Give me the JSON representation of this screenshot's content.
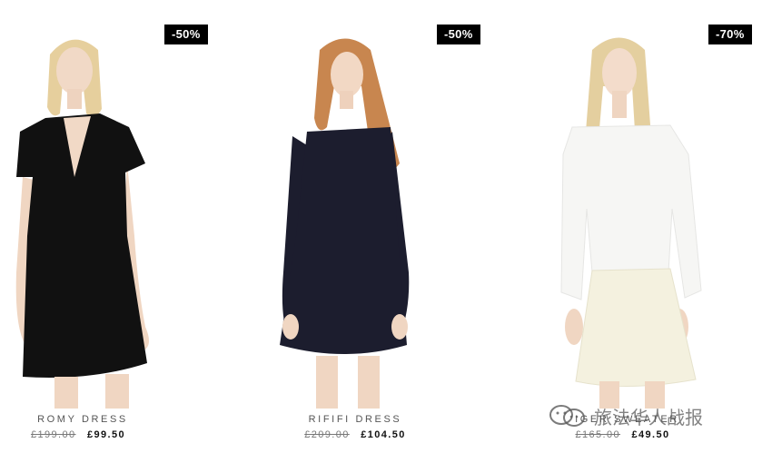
{
  "products": [
    {
      "name": "ROMY DRESS",
      "discount": "-50%",
      "old_price": "£199.00",
      "new_price": "£99.50",
      "garment_color": "#111111"
    },
    {
      "name": "RIFIFI DRESS",
      "discount": "-50%",
      "old_price": "£209.00",
      "new_price": "£104.50",
      "garment_color": "#1c1d2e"
    },
    {
      "name": "IGER SWEATER",
      "discount": "-70%",
      "old_price": "£165.00",
      "new_price": "£49.50",
      "garment_color": "#f6f6f4"
    }
  ],
  "watermark": {
    "text": "旅法华人战报"
  }
}
